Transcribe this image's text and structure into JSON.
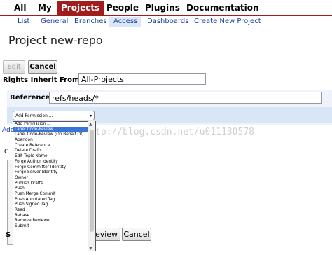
{
  "top_nav": [
    "All",
    "My",
    "Projects",
    "People",
    "Plugins",
    "Documentation"
  ],
  "sub_nav": [
    "List",
    "General",
    "Branches",
    "Access",
    "Dashboards",
    "Create New Project"
  ],
  "page_title": "Project new-repo",
  "buttons": {
    "edit": "Edit",
    "cancel": "Cancel"
  },
  "rights_inherit": {
    "label": "Rights Inherit From:",
    "value": "All-Projects"
  },
  "reference": {
    "label": "Reference:",
    "value": "refs/heads/*"
  },
  "add_permission": {
    "selected": "Add Permission ...",
    "options": [
      "Add Permission ...",
      "Label Code-Review",
      "Label Code-Review (On Behalf Of)",
      "Abandon",
      "Create Reference",
      "Delete Drafts",
      "Edit Topic Name",
      "Forge Author Identity",
      "Forge Committer Identity",
      "Forge Server Identity",
      "Owner",
      "Publish Drafts",
      "Push",
      "Push Merge Commit",
      "Push Annotated Tag",
      "Push Signed Tag",
      "Read",
      "Rebase",
      "Remove Reviewer",
      "Submit"
    ],
    "highlighted_index": 1
  },
  "bottom_buttons": {
    "review_fragment": "eview",
    "cancel": "Cancel"
  },
  "fragments": {
    "add": "Add",
    "c": "C",
    "s": "S"
  },
  "watermark": "tp://blog.csdn.net/u011130578",
  "colors": {
    "accent": "#a11c1c",
    "link": "#1b3fa0",
    "highlight": "#3875d7",
    "panel": "#eef3fb"
  }
}
